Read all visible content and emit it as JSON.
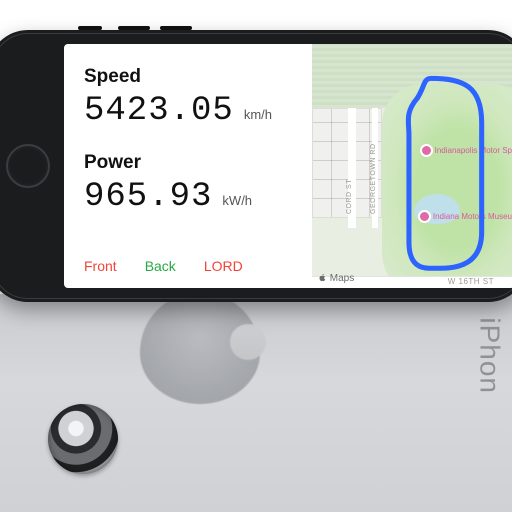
{
  "metrics": {
    "speed": {
      "label": "Speed",
      "value": "5423.05",
      "unit": "km/h"
    },
    "power": {
      "label": "Power",
      "value": "965.93",
      "unit": "kW/h"
    }
  },
  "tabs": {
    "front": "Front",
    "back": "Back",
    "lord": "LORD"
  },
  "map": {
    "attribution": "Maps",
    "road_label": "W 16TH ST",
    "street1": "CORD ST",
    "street2": "GEORGETOWN RD",
    "poi1": "Indianapolis Motor Sp",
    "poi2": "Indiana Motors Museu"
  },
  "device_back": {
    "brand": "iPhon"
  }
}
